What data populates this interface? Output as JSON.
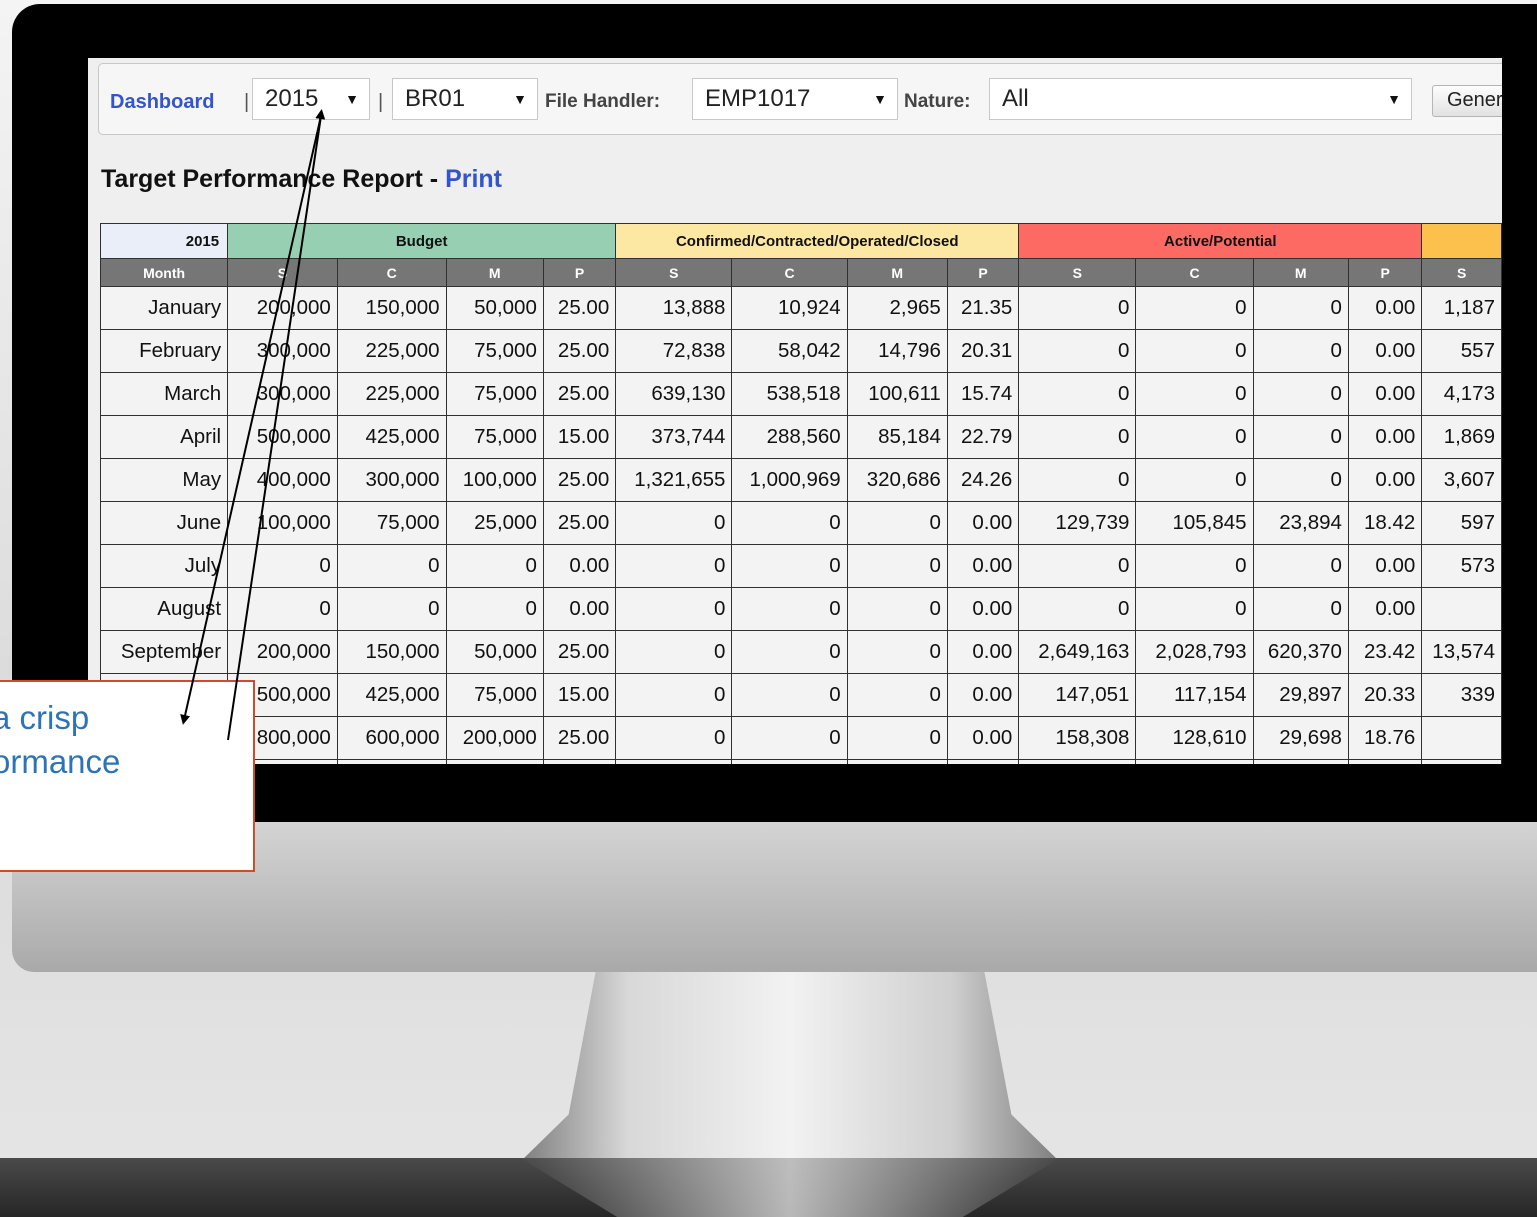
{
  "toolbar": {
    "dashboard_label": "Dashboard",
    "sep1": "|",
    "year_value": "2015",
    "sep2": "|",
    "branch_value": "BR01",
    "file_handler_label": "File Handler:",
    "file_handler_value": "EMP1017",
    "nature_label": "Nature:",
    "nature_value": "All",
    "generate_label": "Genera",
    "dropdown_arrow": "▼"
  },
  "report": {
    "title": "Target Performance Report - ",
    "print_label": "Print"
  },
  "table": {
    "year": "2015",
    "groups": [
      "Budget",
      "Confirmed/Contracted/Operated/Closed",
      "Active/Potential",
      ""
    ],
    "month_header": "Month",
    "sub_headers": [
      "S",
      "C",
      "M",
      "P",
      "S",
      "C",
      "M",
      "P",
      "S",
      "C",
      "M",
      "P",
      "S"
    ],
    "rows": [
      {
        "month": "January",
        "cells": [
          "200,000",
          "150,000",
          "50,000",
          "25.00",
          "13,888",
          "10,924",
          "2,965",
          "21.35",
          "0",
          "0",
          "0",
          "0.00",
          "1,187"
        ]
      },
      {
        "month": "February",
        "cells": [
          "300,000",
          "225,000",
          "75,000",
          "25.00",
          "72,838",
          "58,042",
          "14,796",
          "20.31",
          "0",
          "0",
          "0",
          "0.00",
          "557"
        ]
      },
      {
        "month": "March",
        "cells": [
          "300,000",
          "225,000",
          "75,000",
          "25.00",
          "639,130",
          "538,518",
          "100,611",
          "15.74",
          "0",
          "0",
          "0",
          "0.00",
          "4,173"
        ]
      },
      {
        "month": "April",
        "cells": [
          "500,000",
          "425,000",
          "75,000",
          "15.00",
          "373,744",
          "288,560",
          "85,184",
          "22.79",
          "0",
          "0",
          "0",
          "0.00",
          "1,869"
        ]
      },
      {
        "month": "May",
        "cells": [
          "400,000",
          "300,000",
          "100,000",
          "25.00",
          "1,321,655",
          "1,000,969",
          "320,686",
          "24.26",
          "0",
          "0",
          "0",
          "0.00",
          "3,607"
        ]
      },
      {
        "month": "June",
        "cells": [
          "100,000",
          "75,000",
          "25,000",
          "25.00",
          "0",
          "0",
          "0",
          "0.00",
          "129,739",
          "105,845",
          "23,894",
          "18.42",
          "597"
        ]
      },
      {
        "month": "July",
        "cells": [
          "0",
          "0",
          "0",
          "0.00",
          "0",
          "0",
          "0",
          "0.00",
          "0",
          "0",
          "0",
          "0.00",
          "573"
        ]
      },
      {
        "month": "August",
        "cells": [
          "0",
          "0",
          "0",
          "0.00",
          "0",
          "0",
          "0",
          "0.00",
          "0",
          "0",
          "0",
          "0.00",
          ""
        ]
      },
      {
        "month": "September",
        "cells": [
          "200,000",
          "150,000",
          "50,000",
          "25.00",
          "0",
          "0",
          "0",
          "0.00",
          "2,649,163",
          "2,028,793",
          "620,370",
          "23.42",
          "13,574"
        ]
      },
      {
        "month": "",
        "cells": [
          "500,000",
          "425,000",
          "75,000",
          "15.00",
          "0",
          "0",
          "0",
          "0.00",
          "147,051",
          "117,154",
          "29,897",
          "20.33",
          "339"
        ]
      },
      {
        "month": "",
        "cells": [
          "800,000",
          "600,000",
          "200,000",
          "25.00",
          "0",
          "0",
          "0",
          "0.00",
          "158,308",
          "128,610",
          "29,698",
          "18.76",
          ""
        ]
      },
      {
        "month": "",
        "cells": [
          "",
          "",
          "",
          "",
          "",
          "",
          "",
          "",
          "",
          "",
          "",
          "",
          ""
        ]
      }
    ]
  },
  "callout": {
    "line1": "a crisp",
    "line2": "ormance"
  }
}
